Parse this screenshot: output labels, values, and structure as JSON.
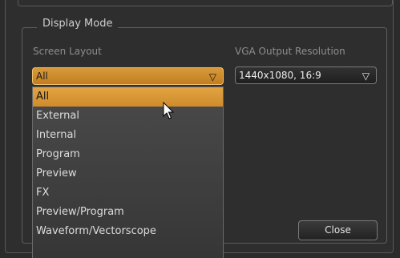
{
  "group": {
    "title": "Display Mode"
  },
  "screen_layout": {
    "label": "Screen Layout",
    "value": "All",
    "options": [
      "All",
      "External",
      "Internal",
      "Program",
      "Preview",
      "FX",
      "Preview/Program",
      "Waveform/Vectorscope"
    ],
    "selected_index": 0
  },
  "vga": {
    "label": "VGA Output Resolution",
    "value": "1440x1080, 16:9"
  },
  "buttons": {
    "close": "Close"
  },
  "icons": {
    "dropdown_arrow": "▽"
  },
  "colors": {
    "accent": "#d8993a",
    "background": "#2b2b2b"
  }
}
